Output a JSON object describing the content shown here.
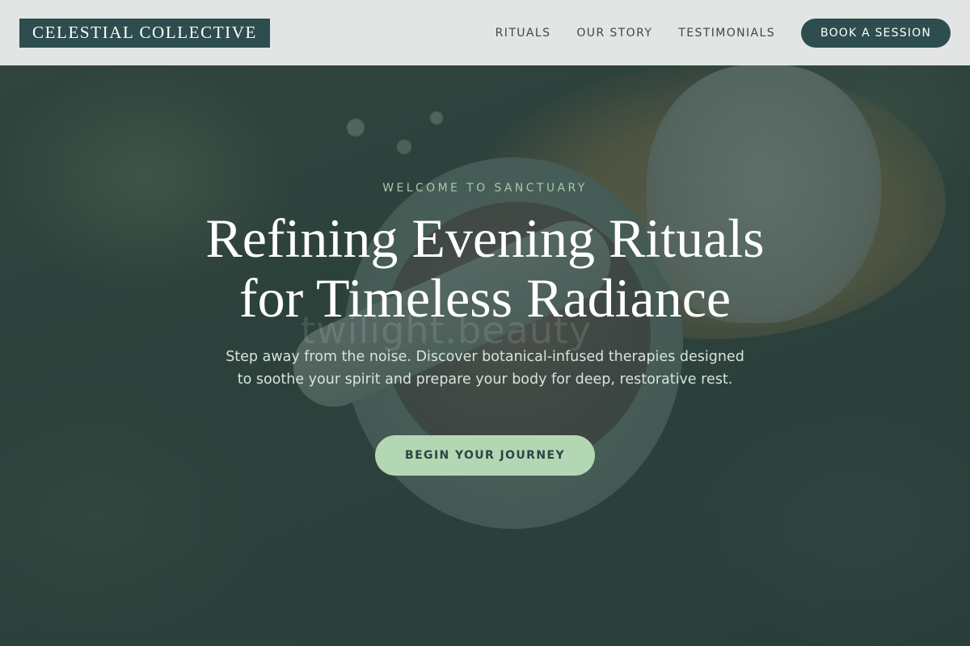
{
  "brand": {
    "name": "CELESTIAL COLLECTIVE"
  },
  "nav": {
    "items": [
      {
        "label": "RITUALS"
      },
      {
        "label": "OUR STORY"
      },
      {
        "label": "TESTIMONIALS"
      }
    ],
    "cta_label": "BOOK A SESSION"
  },
  "hero": {
    "eyebrow": "WELCOME TO SANCTUARY",
    "headline_line1": "Refining Evening Rituals",
    "headline_line2": "for Timeless Radiance",
    "subtext": "Step away from the noise. Discover botanical-infused therapies designed to soothe your spirit and prepare your body for deep, restorative rest.",
    "cta_label": "BEGIN YOUR JOURNEY",
    "background_watermark": "twilight.beauty"
  },
  "colors": {
    "brand_dark": "#2d4d4e",
    "accent_green": "#b3d7b3",
    "eyebrow_green": "#a7c8aa",
    "header_bg": "#eceeed"
  }
}
